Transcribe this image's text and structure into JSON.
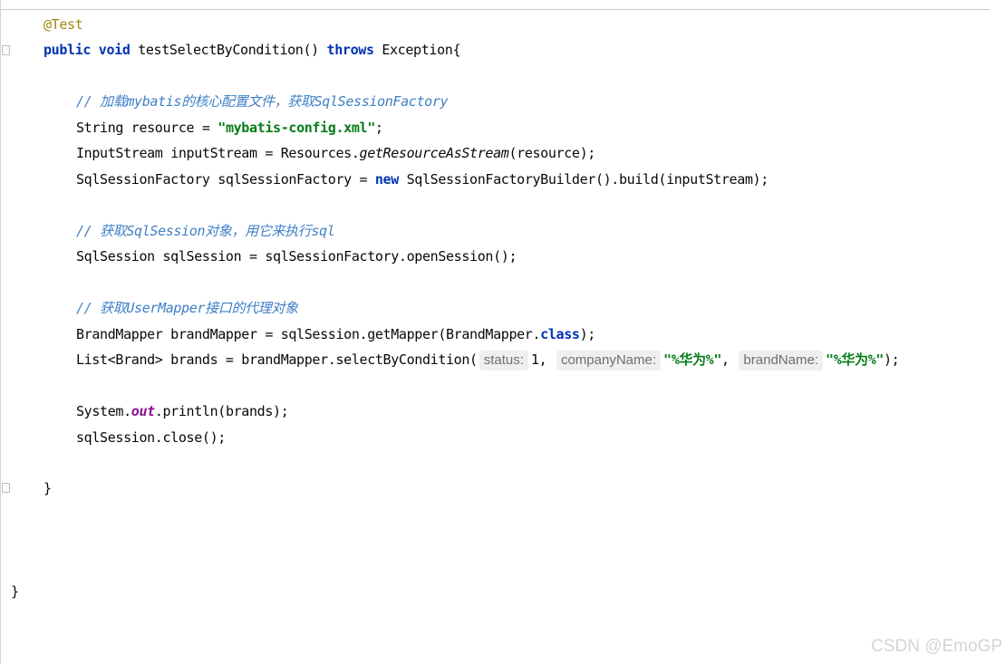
{
  "editor": {
    "annotation": "@Test",
    "method_sig": {
      "public": "public",
      "void": "void",
      "name": " testSelectByCondition() ",
      "throws": "throws",
      "rest": " Exception{"
    },
    "comment1": "// 加载mybatis的核心配置文件，获取SqlSessionFactory",
    "line_resource": {
      "pre": "String resource = ",
      "str": "\"mybatis-config.xml\"",
      "post": ";"
    },
    "line_stream": {
      "pre": "InputStream inputStream = Resources.",
      "method": "getResourceAsStream",
      "post": "(resource);"
    },
    "line_factory": {
      "pre": "SqlSessionFactory sqlSessionFactory = ",
      "new": "new",
      "post": " SqlSessionFactoryBuilder().build(inputStream);"
    },
    "comment2": "// 获取SqlSession对象，用它来执行sql",
    "line_session": "SqlSession sqlSession = sqlSessionFactory.openSession();",
    "comment3": "// 获取UserMapper接口的代理对象",
    "line_mapper": {
      "pre": "BrandMapper brandMapper = sqlSession.getMapper(BrandMapper.",
      "class": "class",
      "post": ");"
    },
    "line_brands": {
      "pre": "List<Brand> brands = brandMapper.selectByCondition(",
      "hint_status": "status:",
      "arg_status": "1, ",
      "hint_company": "companyName:",
      "arg_company": "\"%华为%\"",
      "sep": ", ",
      "hint_brand": "brandName:",
      "arg_brand": "\"%华为%\"",
      "post": ");"
    },
    "line_print": {
      "pre": "System.",
      "field": "out",
      "post": ".println(brands);"
    },
    "line_close": "sqlSession.close();",
    "method_close": "}",
    "class_close": "}"
  },
  "watermark": "CSDN @EmoGP"
}
